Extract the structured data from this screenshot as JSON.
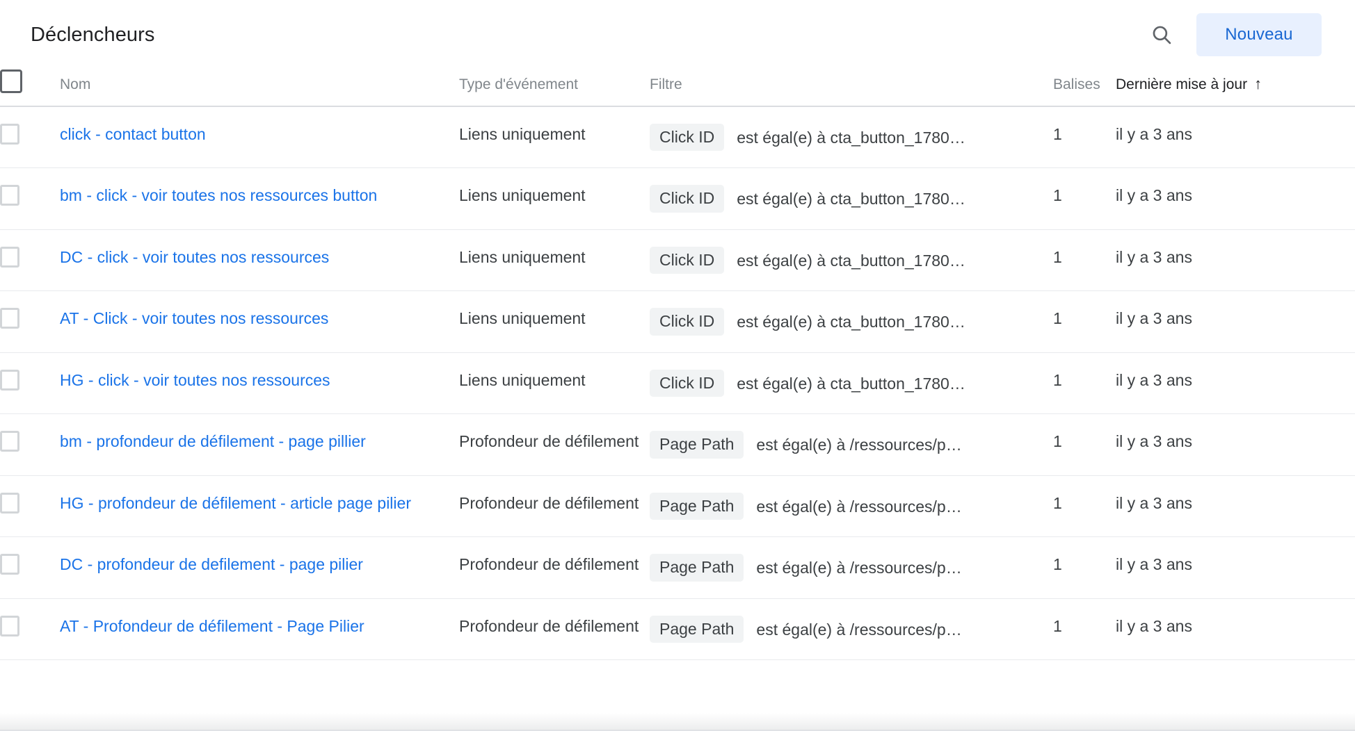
{
  "header": {
    "title": "Déclencheurs",
    "search_icon": "search-icon",
    "new_button_label": "Nouveau"
  },
  "table": {
    "columns": {
      "name": "Nom",
      "event_type": "Type d'événement",
      "filter": "Filtre",
      "tags": "Balises",
      "last_updated": "Dernière mise à jour",
      "sort_arrow": "↑"
    },
    "sorted_by": "Dernière mise à jour",
    "sort_direction": "asc",
    "rows": [
      {
        "name": "click - contact button",
        "event_type": "Liens uniquement",
        "filter_chip": "Click ID",
        "filter_expr": "est égal(e) à cta_button_1780…",
        "tags": "1",
        "last_updated": "il y a 3 ans"
      },
      {
        "name": "bm - click - voir toutes nos ressources button",
        "event_type": "Liens uniquement",
        "filter_chip": "Click ID",
        "filter_expr": "est égal(e) à cta_button_1780…",
        "tags": "1",
        "last_updated": "il y a 3 ans"
      },
      {
        "name": "DC - click - voir toutes nos ressources",
        "event_type": "Liens uniquement",
        "filter_chip": "Click ID",
        "filter_expr": "est égal(e) à cta_button_1780…",
        "tags": "1",
        "last_updated": "il y a 3 ans"
      },
      {
        "name": "AT - Click - voir toutes nos ressources",
        "event_type": "Liens uniquement",
        "filter_chip": "Click ID",
        "filter_expr": "est égal(e) à cta_button_1780…",
        "tags": "1",
        "last_updated": "il y a 3 ans"
      },
      {
        "name": "HG - click - voir toutes nos ressources",
        "event_type": "Liens uniquement",
        "filter_chip": "Click ID",
        "filter_expr": "est égal(e) à cta_button_1780…",
        "tags": "1",
        "last_updated": "il y a 3 ans"
      },
      {
        "name": "bm - profondeur de défilement - page pillier",
        "event_type": "Profondeur de défilement",
        "filter_chip": "Page Path",
        "filter_expr": "est égal(e) à /ressources/p…",
        "tags": "1",
        "last_updated": "il y a 3 ans"
      },
      {
        "name": "HG - profondeur de défilement - article page pilier",
        "event_type": "Profondeur de défilement",
        "filter_chip": "Page Path",
        "filter_expr": "est égal(e) à /ressources/p…",
        "tags": "1",
        "last_updated": "il y a 3 ans"
      },
      {
        "name": "DC - profondeur de defilement - page pilier",
        "event_type": "Profondeur de défilement",
        "filter_chip": "Page Path",
        "filter_expr": "est égal(e) à /ressources/p…",
        "tags": "1",
        "last_updated": "il y a 3 ans"
      },
      {
        "name": "AT - Profondeur de défilement - Page Pilier",
        "event_type": "Profondeur de défilement",
        "filter_chip": "Page Path",
        "filter_expr": "est égal(e) à /ressources/p…",
        "tags": "1",
        "last_updated": "il y a 3 ans"
      }
    ]
  },
  "colors": {
    "link": "#1a73e8",
    "accent_button_bg": "#e8f0fe",
    "accent_button_text": "#1967d2",
    "chip_bg": "#f1f3f4",
    "text_primary": "#202124",
    "text_secondary": "#3c4043",
    "text_muted": "#80868b"
  }
}
